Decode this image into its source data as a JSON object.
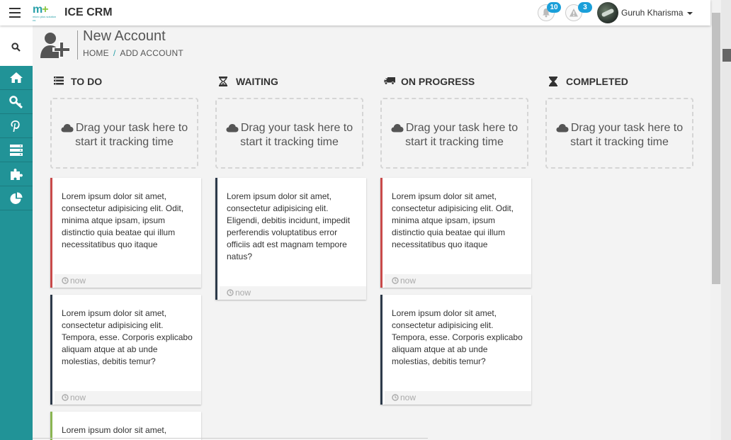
{
  "app": {
    "title": "ICE CRM",
    "logo_text": "m+",
    "logo_tagline": "micro plus solution co."
  },
  "header": {
    "notifications": [
      {
        "icon": "bell-icon",
        "count": "10"
      },
      {
        "icon": "warning-icon",
        "count": "3"
      }
    ],
    "user": {
      "name": "Guruh Kharisma"
    }
  },
  "sidebar": {
    "items": [
      {
        "icon": "search-icon"
      },
      {
        "icon": "home-icon"
      },
      {
        "icon": "key-icon"
      },
      {
        "icon": "pinterest-icon"
      },
      {
        "icon": "server-icon"
      },
      {
        "icon": "puzzle-icon"
      },
      {
        "icon": "pie-chart-icon"
      }
    ]
  },
  "page": {
    "title": "New Account",
    "breadcrumb": [
      "HOME",
      "/",
      "ADD ACCOUNT"
    ]
  },
  "dropzone_text": "Drag your task here to start it tracking time",
  "columns": [
    {
      "title": "TO DO",
      "icon": "list-icon",
      "cards": [
        {
          "text": "Lorem ipsum dolor sit amet, consectetur adipisicing elit. Odit, minima atque ipsam, ipsum distinctio quia beatae qui illum necessitatibus quo itaque",
          "time": "now",
          "accent": "#c94a4a"
        },
        {
          "text": "Lorem ipsum dolor sit amet, consectetur adipisicing elit. Tempora, esse. Corporis explicabo aliquam atque at ab unde molestias, debitis temur?",
          "time": "now",
          "accent": "#2d3a4a"
        },
        {
          "text": "Lorem ipsum dolor sit amet,",
          "time": "",
          "accent": "#8ab552"
        }
      ]
    },
    {
      "title": "WAITING",
      "icon": "hourglass-icon",
      "cards": [
        {
          "text": "Lorem ipsum dolor sit amet, consectetur adipisicing elit. Eligendi, debitis incidunt, impedit perferendis voluptatibus error officiis adt est magnam tempore natus?",
          "time": "now",
          "accent": "#2d3a4a"
        }
      ]
    },
    {
      "title": "ON PROGRESS",
      "icon": "truck-icon",
      "cards": [
        {
          "text": "Lorem ipsum dolor sit amet, consectetur adipisicing elit. Odit, minima atque ipsam, ipsum distinctio quia beatae qui illum necessitatibus quo itaque",
          "time": "now",
          "accent": "#c94a4a"
        },
        {
          "text": "Lorem ipsum dolor sit amet, consectetur adipisicing elit. Tempora, esse. Corporis explicabo aliquam atque at ab unde molestias, debitis temur?",
          "time": "now",
          "accent": "#2d3a4a"
        }
      ]
    },
    {
      "title": "COMPLETED",
      "icon": "hourglass-end-icon",
      "cards": []
    }
  ]
}
